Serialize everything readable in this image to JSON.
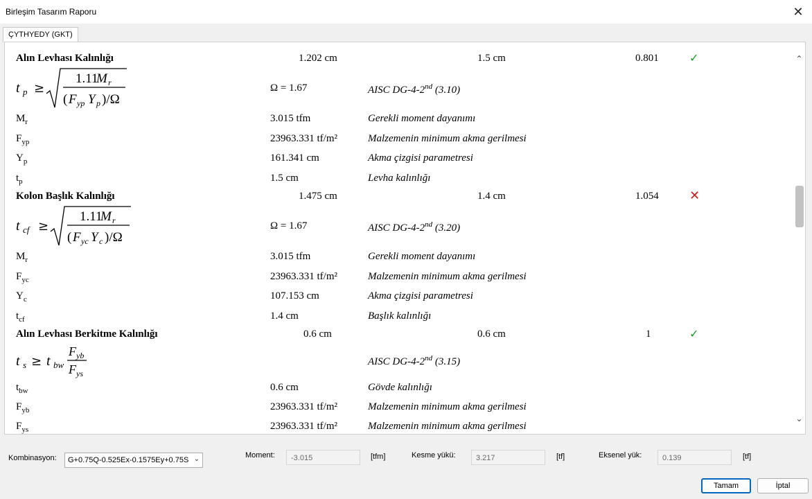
{
  "window": {
    "title": "Birleşim Tasarım Raporu",
    "close_glyph": "✕"
  },
  "tab": {
    "label": "ÇYTHYEDY (GKT)"
  },
  "report": {
    "sections": [
      {
        "title": "Alın Levhası Kalınlığı",
        "required": "1.202 cm",
        "provided": "1.5 cm",
        "ratio": "0.801",
        "status": "ok",
        "formula_var": "t",
        "formula_var_sub": "p",
        "formula_num_coef": "1.11",
        "formula_num_var": "M",
        "formula_num_sub": "r",
        "formula_den_F_sub": "yp",
        "formula_den_Y_sub": "p",
        "omega": "Ω = 1.67",
        "reference": "AISC DG-4-2",
        "reference_sup": "nd",
        "reference_eq": "(3.10)",
        "params": [
          {
            "sym": "M",
            "sub": "r",
            "value": "3.015 tfm",
            "desc": "Gerekli moment dayanımı"
          },
          {
            "sym": "F",
            "sub": "yp",
            "value": "23963.331 tf/m²",
            "desc": "Malzemenin minimum akma gerilmesi"
          },
          {
            "sym": "Y",
            "sub": "p",
            "value": "161.341 cm",
            "desc": "Akma çizgisi parametresi"
          },
          {
            "sym": "t",
            "sub": "p",
            "value": "1.5 cm",
            "desc": "Levha kalınlığı"
          }
        ]
      },
      {
        "title": "Kolon Başlık Kalınlığı",
        "required": "1.475 cm",
        "provided": "1.4 cm",
        "ratio": "1.054",
        "status": "fail",
        "formula_var": "t",
        "formula_var_sub": "cf",
        "formula_num_coef": "1.11",
        "formula_num_var": "M",
        "formula_num_sub": "r",
        "formula_den_F_sub": "yc",
        "formula_den_Y_sub": "c",
        "omega": "Ω = 1.67",
        "reference": "AISC DG-4-2",
        "reference_sup": "nd",
        "reference_eq": "(3.20)",
        "params": [
          {
            "sym": "M",
            "sub": "r",
            "value": "3.015 tfm",
            "desc": "Gerekli moment dayanımı"
          },
          {
            "sym": "F",
            "sub": "yc",
            "value": "23963.331 tf/m²",
            "desc": "Malzemenin minimum akma gerilmesi"
          },
          {
            "sym": "Y",
            "sub": "c",
            "value": "107.153 cm",
            "desc": "Akma çizgisi parametresi"
          },
          {
            "sym": "t",
            "sub": "cf",
            "value": "1.4 cm",
            "desc": "Başlık kalınlığı"
          }
        ]
      },
      {
        "title": "Alın Levhası Berkitme Kalınlığı",
        "required": "0.6 cm",
        "provided": "0.6 cm",
        "ratio": "1",
        "status": "ok",
        "formula_lhs": "t",
        "formula_lhs_sub": "s",
        "formula_rhs": "t",
        "formula_rhs_sub": "bw",
        "formula_num": "F",
        "formula_num_sub": "yb",
        "formula_den": "F",
        "formula_den_sub": "ys",
        "reference": "AISC DG-4-2",
        "reference_sup": "nd",
        "reference_eq": "(3.15)",
        "params": [
          {
            "sym": "t",
            "sub": "bw",
            "value": "0.6 cm",
            "desc": "Gövde kalınlığı"
          },
          {
            "sym": "F",
            "sub": "yb",
            "value": "23963.331 tf/m²",
            "desc": "Malzemenin minimum akma gerilmesi"
          },
          {
            "sym": "F",
            "sub": "ys",
            "value": "23963.331 tf/m²",
            "desc": "Malzemenin minimum akma gerilmesi"
          }
        ]
      }
    ],
    "check_glyph": "✓",
    "cross_glyph": "✕"
  },
  "scrollbar": {
    "up_glyph": "⌃",
    "down_glyph": "⌄"
  },
  "footer": {
    "combination_label": "Kombinasyon:",
    "combination_value": "G+0.75Q-0.525Ex-0.1575Ey+0.75S",
    "moment_label": "Moment:",
    "moment_value": "-3.015",
    "moment_unit": "[tfm]",
    "shear_label": "Kesme yükü:",
    "shear_value": "3.217",
    "shear_unit": "[tf]",
    "axial_label": "Eksenel yük:",
    "axial_value": "0.139",
    "axial_unit": "[tf]",
    "ok_button": "Tamam",
    "cancel_button": "İptal"
  }
}
